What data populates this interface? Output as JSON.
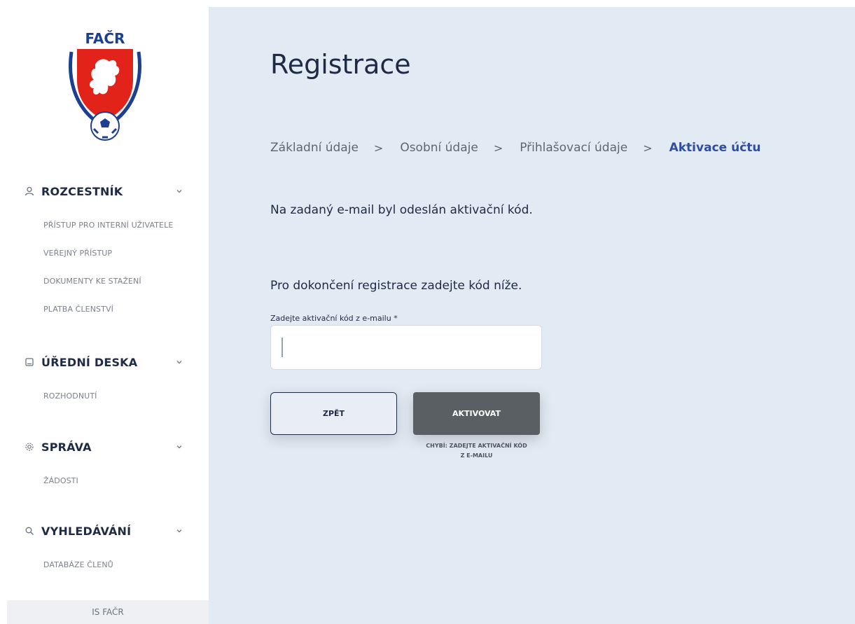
{
  "sidebar": {
    "logo_text": "FAČR",
    "sections": [
      {
        "title": "ROZCESTNÍK",
        "icon": "user-icon",
        "items": [
          "PŘÍSTUP PRO INTERNÍ UŽIVATELE",
          "VEŘEJNÝ PŘÍSTUP",
          "DOKUMENTY KE STAŽENÍ",
          "PLATBA ČLENSTVÍ"
        ]
      },
      {
        "title": "ÚŘEDNÍ DESKA",
        "icon": "board-icon",
        "items": [
          "ROZHODNUTÍ"
        ]
      },
      {
        "title": "SPRÁVA",
        "icon": "gear-icon",
        "items": [
          "ŽÁDOSTI"
        ]
      },
      {
        "title": "VYHLEDÁVÁNÍ",
        "icon": "search-icon",
        "items": [
          "DATABÁZE ČLENŮ"
        ]
      }
    ],
    "footer": "IS FAČR"
  },
  "main": {
    "title": "Registrace",
    "breadcrumb": [
      {
        "label": "Základní údaje",
        "active": false
      },
      {
        "label": "Osobní údaje",
        "active": false
      },
      {
        "label": "Přihlašovací údaje",
        "active": false
      },
      {
        "label": "Aktivace účtu",
        "active": true
      }
    ],
    "breadcrumb_separator": ">",
    "info": "Na zadaný e-mail byl odeslán aktivační kód.",
    "instruction": "Pro dokončení registrace zadejte kód níže.",
    "code_field": {
      "label": "Zadejte aktivační kód z e-mailu *",
      "value": ""
    },
    "back_label": "ZPĚT",
    "activate_label": "AKTIVOVAT",
    "error_line1": "CHYBÍ: ZADEJTE AKTIVAČNÍ KÓD",
    "error_line2": "Z E-MAILU"
  },
  "colors": {
    "main_bg": "#e2eaf3",
    "accent": "#2f4ea0",
    "activate_bg": "#5a5f63",
    "logo_red": "#e2231a",
    "logo_blue": "#1d3f8f"
  }
}
